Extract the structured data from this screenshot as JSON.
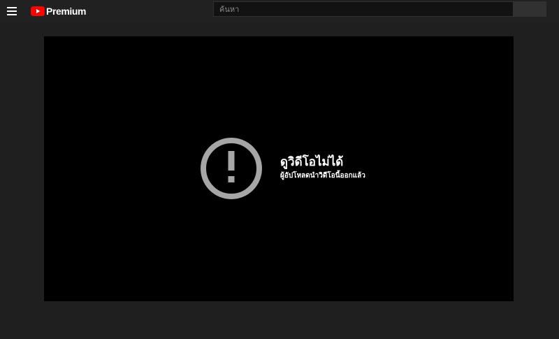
{
  "header": {
    "menu_icon": "hamburger-menu-icon",
    "logo": {
      "icon": "youtube-play-logo-icon",
      "text": "Premium",
      "brand_color": "#ff0000"
    },
    "search": {
      "placeholder": "ค้นหา",
      "value": ""
    }
  },
  "player": {
    "error_icon": "exclamation-circle-icon",
    "error_icon_color": "#a6a6a6",
    "error_title": "ดูวิดีโอไม่ได้",
    "error_message": "ผู้อัปโหลดนำวิดีโอนี้ออกแล้ว"
  },
  "colors": {
    "page_background": "#1f1f1f",
    "header_background": "#212121",
    "player_background": "#000000"
  }
}
